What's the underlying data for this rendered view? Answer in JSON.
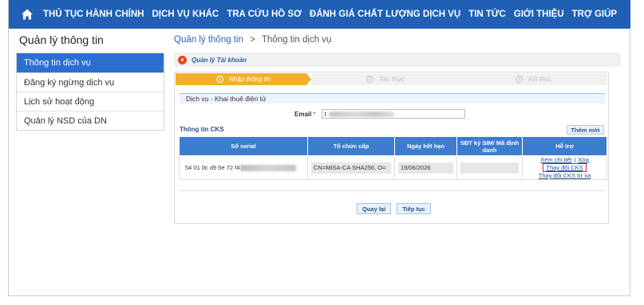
{
  "topnav": {
    "items": [
      "THỦ TỤC HÀNH CHÍNH",
      "DỊCH VỤ KHÁC",
      "TRA CỨU HỒ SƠ",
      "ĐÁNH GIÁ CHẤT LƯỢNG DỊCH VỤ",
      "TIN TỨC",
      "GIỚI THIỆU",
      "TRỢ GIÚP"
    ]
  },
  "sidebar": {
    "title": "Quản lý thông tin",
    "items": [
      "Thông tin dịch vụ",
      "Đăng ký ngừng dịch vụ",
      "Lịch sử hoạt động",
      "Quản lý NSD của DN"
    ]
  },
  "breadcrumb": {
    "parent": "Quản lý thông tin",
    "separator": ">",
    "current": "Thông tin dịch vụ"
  },
  "account_bar": {
    "label": "Quản lý Tài khoản"
  },
  "steps": [
    {
      "num": "1",
      "label": "Nhập thông tin"
    },
    {
      "num": "2",
      "label": "Xác thực"
    },
    {
      "num": "3",
      "label": "Kết thúc"
    }
  ],
  "form": {
    "section_title": "Dịch vụ - Khai thuế điện tử",
    "email_label": "Email",
    "email_required": "*",
    "email_value": "t"
  },
  "cks": {
    "title": "Thông tin CKS",
    "add_button": "Thêm mới",
    "columns": [
      "Số serial",
      "Tổ chức cấp",
      "Ngày hết hạn",
      "SĐT ký SIM/ Mã định danh",
      "Hỗ trợ"
    ],
    "row": {
      "serial": "54 01 0c d9 5e 72 f4",
      "issuer": "CN=MISA-CA SHA256, O=",
      "expiry": "19/06/2026",
      "sim": "",
      "support": {
        "view": "Xem chi tiết",
        "sep": "|",
        "delete": "Xóa",
        "change": "Thay đổi CKS",
        "change_remote": "Thay đổi CKS từ xa"
      }
    }
  },
  "actions": {
    "back": "Quay lại",
    "next": "Tiếp tục"
  },
  "colors": {
    "nav": "#1f5fb4",
    "sidebar_active": "#2c6fd0",
    "step_active": "#f2b02a",
    "table_header": "#3c7ccf",
    "highlight": "#d9272e"
  }
}
